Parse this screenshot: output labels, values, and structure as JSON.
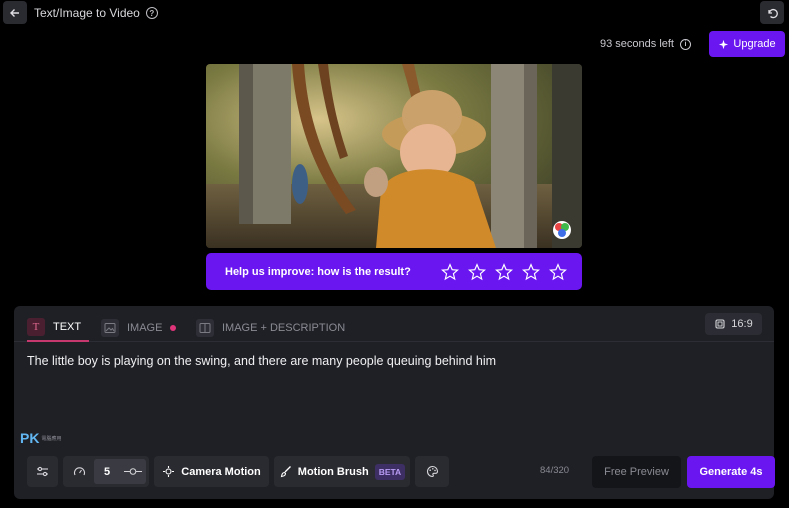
{
  "header": {
    "title": "Text/Image to Video",
    "help_icon": "?",
    "back_icon": "arrow-left",
    "undo_icon": "undo"
  },
  "status": {
    "timer_text": "93 seconds left",
    "info_icon": "i",
    "upgrade_label": "Upgrade"
  },
  "preview": {
    "description_icon": "color-wheel"
  },
  "rating": {
    "prompt": "Help us improve: how is the result?",
    "stars": 5,
    "value": 0
  },
  "tabs": [
    {
      "label": "TEXT",
      "icon": "T",
      "active": true
    },
    {
      "label": "IMAGE",
      "icon": "image",
      "active": false
    },
    {
      "label": "IMAGE + DESCRIPTION",
      "icon": "split",
      "active": false
    }
  ],
  "aspect_ratio": "16:9",
  "prompt_text": "The little boy is playing on the swing, and there are many people queuing behind him",
  "watermark": {
    "logo": "PK",
    "text": "電腦應用"
  },
  "toolbar": {
    "motion_value": "5",
    "camera_motion_label": "Camera Motion",
    "motion_brush_label": "Motion Brush",
    "beta_label": "BETA",
    "char_count": "84/320",
    "free_preview_label": "Free Preview",
    "generate_label": "Generate 4s"
  },
  "colors": {
    "accent": "#6a16f0",
    "panel": "#1f2026",
    "tab_underline": "#c6386e"
  }
}
